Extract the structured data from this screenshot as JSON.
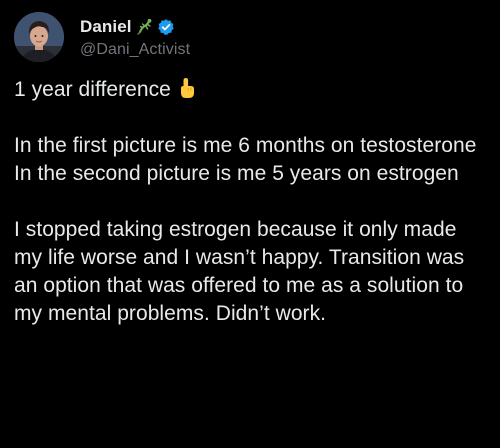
{
  "author": {
    "display_name": "Daniel",
    "handle": "@Dani_Activist",
    "name_emoji_icon": "lizard-icon",
    "verified_icon": "verified-badge-icon",
    "verified_color": "#1d9bf0"
  },
  "tweet": {
    "line1": "1 year difference",
    "line1_emoji_icon": "index-pointing-up-icon",
    "para2_line1": "In the first picture is me 6 months on testosterone",
    "para2_line2": "In the second picture is me 5 years on estrogen",
    "para3": "I stopped taking estrogen because it only made my life worse and I wasn’t happy. Transition was an option that was offered to me as a solution to my mental problems. Didn’t work."
  },
  "colors": {
    "background": "#000000",
    "text": "#e7e9ea",
    "secondary_text": "#71767b",
    "accent": "#1d9bf0"
  }
}
